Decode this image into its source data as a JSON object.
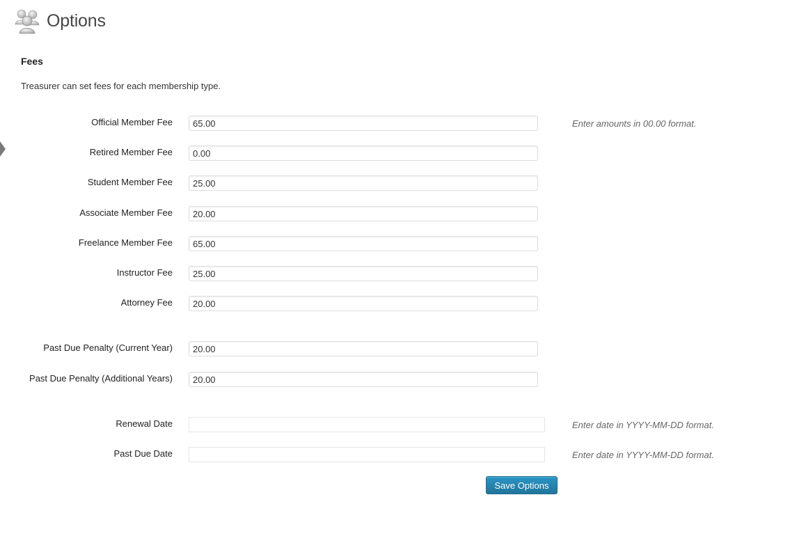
{
  "page": {
    "title": "Options",
    "icon": "users-icon"
  },
  "section": {
    "heading": "Fees",
    "description": "Treasurer can set fees for each membership type."
  },
  "fields": [
    {
      "label": "Official Member Fee",
      "value": "65.00",
      "hint": "Enter amounts in 00.00 format."
    },
    {
      "label": "Retired Member Fee",
      "value": "0.00"
    },
    {
      "label": "Student Member Fee",
      "value": "25.00"
    },
    {
      "label": "Associate Member Fee",
      "value": "20.00"
    },
    {
      "label": "Freelance Member Fee",
      "value": "65.00"
    },
    {
      "label": "Instructor Fee",
      "value": "25.00"
    },
    {
      "label": "Attorney Fee",
      "value": "20.00"
    },
    {
      "label": "Past Due Penalty (Current Year)",
      "value": "20.00"
    },
    {
      "label": "Past Due Penalty (Additional Years)",
      "value": "20.00"
    },
    {
      "label": "Renewal Date",
      "value": "",
      "hint": "Enter date in YYYY-MM-DD format."
    },
    {
      "label": "Past Due Date",
      "value": "",
      "hint": "Enter date in YYYY-MM-DD format."
    }
  ],
  "actions": {
    "save_label": "Save Options"
  },
  "colors": {
    "button": "#21759b",
    "title": "#464646",
    "hint": "#666666"
  }
}
